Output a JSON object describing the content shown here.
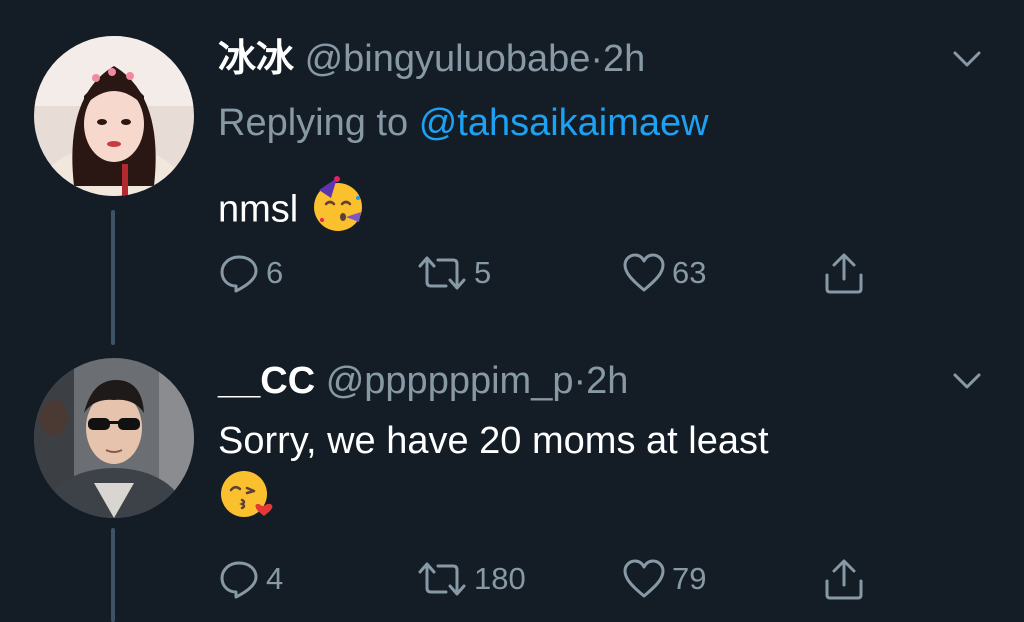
{
  "tweets": [
    {
      "name": "冰冰",
      "handle": "@bingyuluobabe",
      "separator": "·",
      "time": "2h",
      "replying_prefix": "Replying to",
      "replying_to": "@tahsaikaimaew",
      "text": "nmsl",
      "emoji": "partying-face-emoji",
      "replies": "6",
      "retweets": "5",
      "likes": "63"
    },
    {
      "name": "__CC",
      "handle": "@ppppppim_p",
      "separator": "·",
      "time": "2h",
      "text": "Sorry, we have 20 moms at least",
      "emoji": "face-blowing-kiss-emoji",
      "replies": "4",
      "retweets": "180",
      "likes": "79"
    }
  ],
  "colors": {
    "background": "#141d26",
    "secondary_text": "#8899a6",
    "accent": "#1da1f2",
    "thread_line": "#3d5466"
  }
}
